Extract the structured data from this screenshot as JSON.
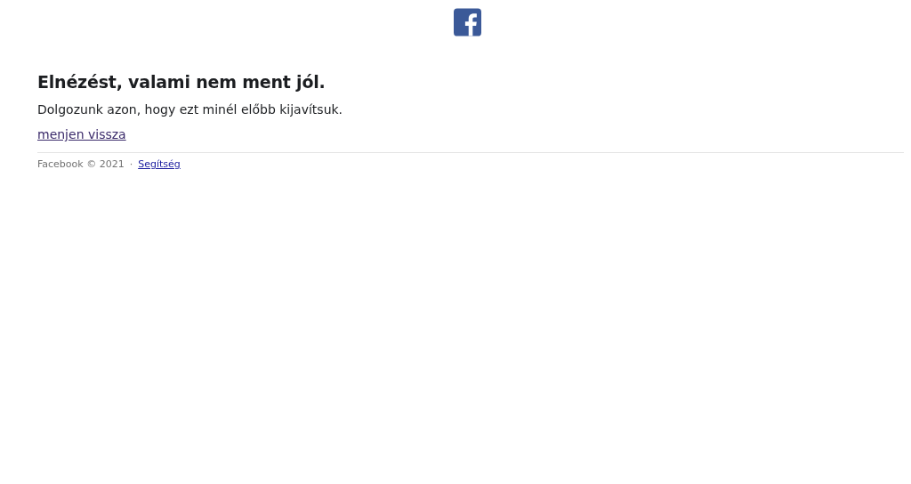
{
  "heading": "Elnézést, valami nem ment jól.",
  "message": "Dolgozunk azon, hogy ezt minél előbb kijavítsuk.",
  "back_link": "menjen vissza",
  "footer": {
    "copyright": "Facebook © 2021",
    "separator": "·",
    "help_link": "Segítség"
  }
}
